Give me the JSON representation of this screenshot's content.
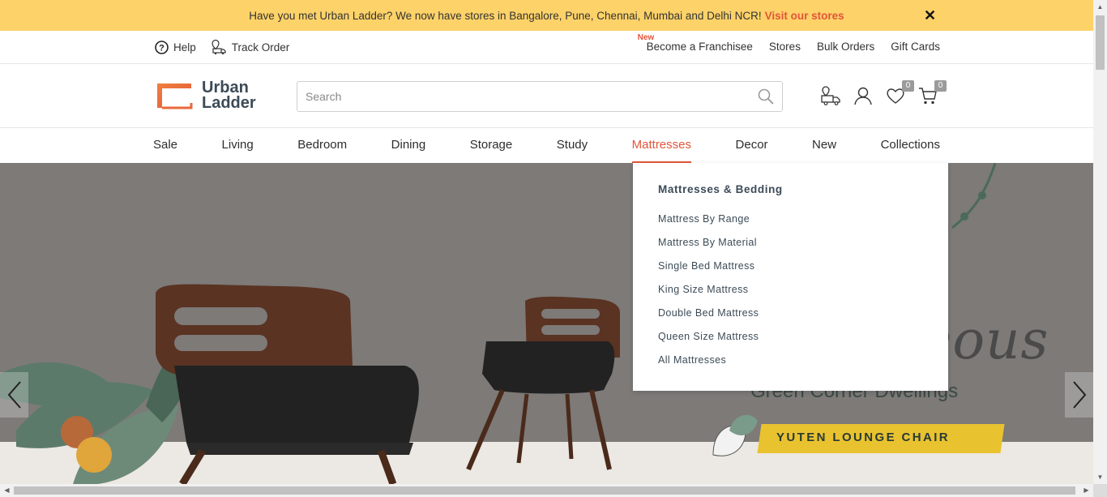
{
  "promo": {
    "text": "Have you met Urban Ladder? We now have stores in Bangalore, Pune, Chennai, Mumbai and Delhi NCR!",
    "link": "Visit our stores",
    "close": "✕"
  },
  "utility": {
    "help": "Help",
    "track_order": "Track Order",
    "new_tag": "New",
    "franchise": "Become a Franchisee",
    "stores": "Stores",
    "bulk_orders": "Bulk Orders",
    "gift_cards": "Gift Cards"
  },
  "header": {
    "logo_line1": "Urban",
    "logo_line2": "Ladder",
    "search_placeholder": "Search",
    "wishlist_count": "0",
    "cart_count": "0"
  },
  "nav": {
    "items": [
      "Sale",
      "Living",
      "Bedroom",
      "Dining",
      "Storage",
      "Study",
      "Mattresses",
      "Decor",
      "New",
      "Collections"
    ],
    "active": "Mattresses"
  },
  "dropdown": {
    "heading": "Mattresses & Bedding",
    "links": [
      "Mattress By Range",
      "Mattress By Material",
      "Single Bed Mattress",
      "King Size Mattress",
      "Double Bed Mattress",
      "Queen Size Mattress",
      "All Mattresses"
    ]
  },
  "hero": {
    "script": "Gorgeous",
    "tagline": "Green Corner Dwellings",
    "product": "YUTEN LOUNGE CHAIR"
  },
  "colors": {
    "accent": "#e2553a",
    "promo_bg": "#fdd269",
    "brand_text": "#3c4b57",
    "hero_bg": "#7b7876",
    "brush": "#e9c230"
  }
}
